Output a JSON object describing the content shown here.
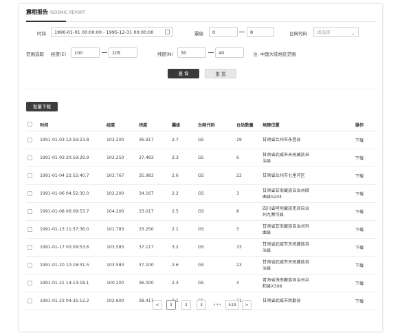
{
  "header": {
    "title": "震相报告",
    "subtitle": "/SEISMIC REPORT"
  },
  "filters": {
    "time_label": "时间",
    "time_value": "1990-01-01 00:00:00 - 1995-12-31 00:00:00",
    "magnitude_label": "震级",
    "magnitude_min": "0",
    "magnitude_max": "8",
    "network_label": "台网代码",
    "network_placeholder": "请选择",
    "range_label": "范围选取",
    "lon_label": "经度(E)",
    "lon_min": "100",
    "lon_max": "105",
    "lat_label": "纬度(N)",
    "lat_min": "30",
    "lat_max": "40",
    "note": "注: 中国大陆地区范围",
    "query_button": "查 询",
    "reset_button": "重 置"
  },
  "batch_download": "批量下载",
  "table": {
    "headers": [
      "时间",
      "经度",
      "纬度",
      "震级",
      "台网代码",
      "台站数量",
      "地理位置",
      "操作"
    ],
    "rows": [
      {
        "time": "1991-01-03 12:59:23.8",
        "lon": "103.200",
        "lat": "36.917",
        "mag": "2.7",
        "net": "GS",
        "stations": "19",
        "loc1": "甘肃省兰州市永登县",
        "loc2": "",
        "action": "下载"
      },
      {
        "time": "1991-01-03 20:59:29.9",
        "lon": "102.250",
        "lat": "37.483",
        "mag": "2.3",
        "net": "GS",
        "stations": "6",
        "loc1": "甘肃省武威市天祝藏族自",
        "loc2": "治县",
        "action": "下载"
      },
      {
        "time": "1991-01-04 22:52:40.7",
        "lon": "103.767",
        "lat": "35.983",
        "mag": "2.6",
        "net": "GS",
        "stations": "22",
        "loc1": "甘肃省兰州市七里河区",
        "loc2": "",
        "action": "下载"
      },
      {
        "time": "1991-01-06 04:52:30.0",
        "lon": "102.200",
        "lat": "34.167",
        "mag": "2.2",
        "net": "GS",
        "stations": "3",
        "loc1": "甘肃省甘南藏族自治州碌",
        "loc2": "曲县S204",
        "action": "下载"
      },
      {
        "time": "1991-01-08 06:09:53.7",
        "lon": "104.200",
        "lat": "33.017",
        "mag": "2.5",
        "net": "GS",
        "stations": "8",
        "loc1": "四川省阿坝藏族羌族自治",
        "loc2": "州九寨沟县",
        "action": "下载"
      },
      {
        "time": "1991-01-13 11:57:36.0",
        "lon": "101.783",
        "lat": "33.250",
        "mag": "2.1",
        "net": "GS",
        "stations": "5",
        "loc1": "甘肃省甘南藏族自治州玛",
        "loc2": "曲县",
        "action": "下载"
      },
      {
        "time": "1991-01-17 00:09:53.6",
        "lon": "103.583",
        "lat": "37.117",
        "mag": "3.2",
        "net": "GS",
        "stations": "33",
        "loc1": "甘肃省武威市天祝藏族自",
        "loc2": "治县",
        "action": "下载"
      },
      {
        "time": "1991-01-20 10:18:31.5",
        "lon": "103.583",
        "lat": "37.100",
        "mag": "2.6",
        "net": "GS",
        "stations": "23",
        "loc1": "甘肃省武威市天祝藏族自",
        "loc2": "治县",
        "action": "下载"
      },
      {
        "time": "1991-01-21 14:13:18.1",
        "lon": "100.200",
        "lat": "36.000",
        "mag": "2.3",
        "net": "GS",
        "stations": "4",
        "loc1": "青海省海南藏族自治州共",
        "loc2": "和县X308",
        "action": "下载"
      },
      {
        "time": "1991-01-23 04:35:12.2",
        "lon": "102.600",
        "lat": "38.417",
        "mag": "2.1",
        "net": "GS",
        "stations": "11",
        "loc1": "甘肃省武威市民勤县",
        "loc2": "",
        "action": "下载"
      }
    ]
  },
  "pagination": {
    "prev": "<",
    "pages": [
      "1",
      "2",
      "3"
    ],
    "ellipsis": "•••",
    "last": "519",
    "next": ">",
    "current": "1"
  }
}
